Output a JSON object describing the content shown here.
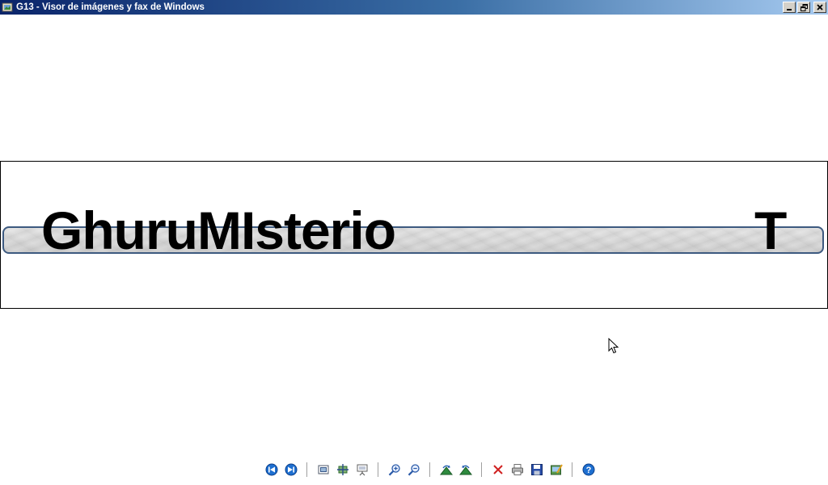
{
  "window": {
    "title": "G13 - Visor de imágenes y fax de Windows",
    "icon": "image-viewer-icon",
    "buttons": [
      "minimize-icon",
      "restore-icon",
      "close-icon"
    ]
  },
  "image": {
    "main_text": "GhuruMIsterio",
    "trailing_letter": "T"
  },
  "toolbar": {
    "items": [
      "previous-image-icon",
      "next-image-icon",
      "best-fit-icon",
      "actual-size-icon",
      "slideshow-icon",
      "zoom-in-icon",
      "zoom-out-icon",
      "rotate-clockwise-icon",
      "rotate-counterclockwise-icon",
      "delete-icon",
      "print-icon",
      "save-icon",
      "edit-icon",
      "help-icon"
    ]
  },
  "colors": {
    "titlebar_start": "#0a246a",
    "titlebar_end": "#a6caf0",
    "banner_border": "#3d5a80",
    "nav_blue": "#1e6fd0",
    "delete_red": "#d02020"
  }
}
